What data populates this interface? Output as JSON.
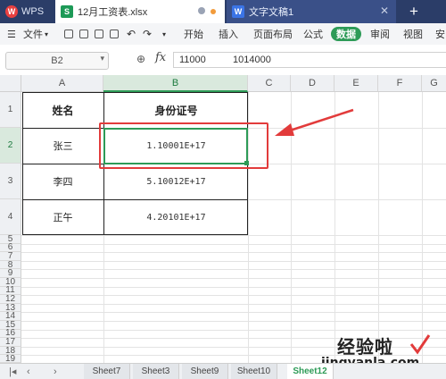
{
  "tabs": {
    "app": "WPS",
    "spreadsheet": "12月工资表.xlsx",
    "document": "文字文稿1",
    "add": "+"
  },
  "menu": {
    "file": "文件",
    "items": [
      "开始",
      "插入",
      "页面布局",
      "公式",
      "数据",
      "审阅",
      "视图",
      "安"
    ],
    "active": "数据"
  },
  "formula_bar": {
    "cell_ref": "B2",
    "fx": "fx",
    "value_part1": "11000",
    "value_part2": "1014000"
  },
  "columns": [
    "A",
    "B",
    "C",
    "D",
    "E",
    "F",
    "G"
  ],
  "rows": [
    "1",
    "2",
    "3",
    "4",
    "5",
    "6",
    "7",
    "8",
    "9",
    "10",
    "11",
    "12",
    "13",
    "14",
    "15",
    "16",
    "17",
    "18",
    "19"
  ],
  "table": {
    "header": {
      "name": "姓名",
      "id": "身份证号"
    },
    "rows": [
      {
        "name": "张三",
        "id": "1.10001E+17"
      },
      {
        "name": "李四",
        "id": "5.10012E+17"
      },
      {
        "name": "正午",
        "id": "4.20101E+17"
      }
    ]
  },
  "sheets": [
    "Sheet7",
    "Sheet3",
    "Sheet9",
    "Sheet10",
    "Sheet12"
  ],
  "active_sheet": "Sheet12",
  "watermark": {
    "title": "经验啦",
    "url": "jingyanla.com"
  },
  "colors": {
    "accent": "#2d9b57",
    "annotation": "#e23b3b",
    "tabbar": "#2b3d68"
  }
}
